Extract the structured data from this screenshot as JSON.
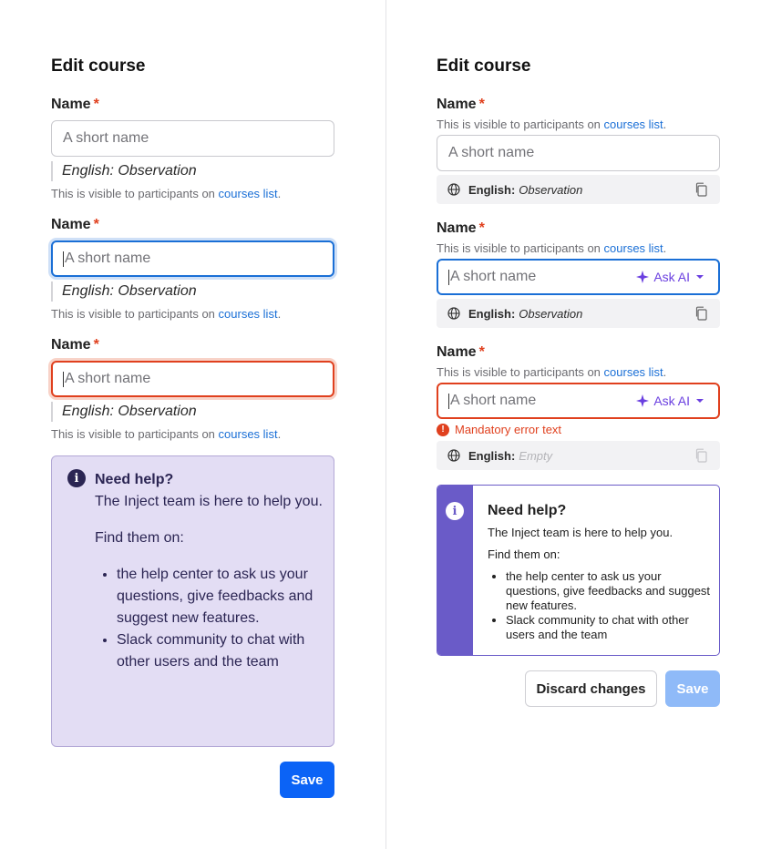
{
  "left": {
    "title": "Edit course",
    "fields": [
      {
        "label": "Name",
        "required": "*",
        "placeholder": "A short name",
        "translation": "English: Observation",
        "helper_text": "This is visible to participants on ",
        "helper_link": "courses list",
        "helper_end": "."
      },
      {
        "label": "Name",
        "required": "*",
        "placeholder": "A short name",
        "translation": "English: Observation",
        "helper_text": "This is visible to participants on ",
        "helper_link": "courses list",
        "helper_end": "."
      },
      {
        "label": "Name",
        "required": "*",
        "placeholder": "A short name",
        "translation": "English: Observation",
        "helper_text": "This is visible to participants on ",
        "helper_link": "courses list",
        "helper_end": "."
      }
    ],
    "help": {
      "title": "Need help?",
      "intro": "The Inject team is here to help you.",
      "find": "Find them on:",
      "items": [
        "the help center to ask us your questions, give feedbacks and suggest new features.",
        "Slack community to chat with other users and the team"
      ]
    },
    "save_label": "Save"
  },
  "right": {
    "title": "Edit course",
    "fields": [
      {
        "label": "Name",
        "required": "*",
        "helper_text": "This is visible to participants on ",
        "helper_link": "courses list",
        "helper_end": ".",
        "placeholder": "A short name",
        "lang": "English:",
        "value": "Observation"
      },
      {
        "label": "Name",
        "required": "*",
        "helper_text": "This is visible to participants on ",
        "helper_link": "courses list",
        "helper_end": ".",
        "placeholder": "A short name",
        "ask_ai": "Ask AI",
        "lang": "English:",
        "value": "Observation"
      },
      {
        "label": "Name",
        "required": "*",
        "helper_text": "This is visible to participants on ",
        "helper_link": "courses list",
        "helper_end": ".",
        "placeholder": "A short name",
        "ask_ai": "Ask AI",
        "error": "Mandatory error text",
        "lang": "English:",
        "value": "Empty"
      }
    ],
    "help": {
      "title": "Need help?",
      "intro": "The Inject team is here to help you.",
      "find": "Find them on:",
      "items": [
        "the help center to ask us your questions, give feedbacks and suggest new features.",
        "Slack community to chat with other users and the team"
      ]
    },
    "discard_label": "Discard changes",
    "save_label": "Save"
  },
  "colors": {
    "primary": "#0b63f6",
    "focus": "#1a6fd6",
    "error": "#e0401e",
    "ai": "#6a3fe0",
    "help_bg": "#e3ddf4",
    "help_accent": "#6a5bc8"
  }
}
